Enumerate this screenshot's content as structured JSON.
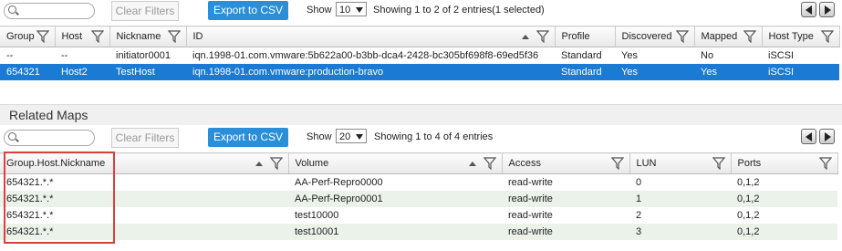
{
  "hosts": {
    "toolbar": {
      "clear_filters": "Clear Filters",
      "export_csv": "Export to CSV",
      "show_label": "Show",
      "page_size": "10",
      "info": "Showing 1 to 2 of 2 entries(1 selected)"
    },
    "columns": [
      "Group",
      "Host",
      "Nickname",
      "ID",
      "Profile",
      "Discovered",
      "Mapped",
      "Host Type"
    ],
    "rows": [
      [
        "--",
        "--",
        "initiator0001",
        "iqn.1998-01.com.vmware:5b622a00-b3bb-dca4-2428-bc305bf698f8-69ed5f36",
        "Standard",
        "Yes",
        "No",
        "iSCSI"
      ],
      [
        "654321",
        "Host2",
        "TestHost",
        "iqn.1998-01.com.vmware:production-bravo",
        "Standard",
        "Yes",
        "Yes",
        "iSCSI"
      ]
    ]
  },
  "related_maps": {
    "title": "Related Maps",
    "toolbar": {
      "clear_filters": "Clear Filters",
      "export_csv": "Export to CSV",
      "show_label": "Show",
      "page_size": "20",
      "info": "Showing 1 to 4 of 4 entries"
    },
    "columns": [
      "Group.Host.Nickname",
      "Volume",
      "Access",
      "LUN",
      "Ports"
    ],
    "rows": [
      [
        "654321.*.*",
        "AA-Perf-Repro0000",
        "read-write",
        "0",
        "0,1,2"
      ],
      [
        "654321.*.*",
        "AA-Perf-Repro0001",
        "read-write",
        "1",
        "0,1,2"
      ],
      [
        "654321.*.*",
        "test10000",
        "read-write",
        "2",
        "0,1,2"
      ],
      [
        "654321.*.*",
        "test10001",
        "read-write",
        "3",
        "0,1,2"
      ]
    ]
  },
  "icons": {
    "search": "search-icon",
    "filter": "funnel-filter-icon",
    "sort": "sort-ascending-icon",
    "prev": "previous-page-icon",
    "next": "next-page-icon"
  },
  "colors": {
    "accent": "#2a8fd8",
    "selected_row": "#1a7ad4",
    "alt_row": "#eaf2ea",
    "highlight": "#d94040"
  }
}
